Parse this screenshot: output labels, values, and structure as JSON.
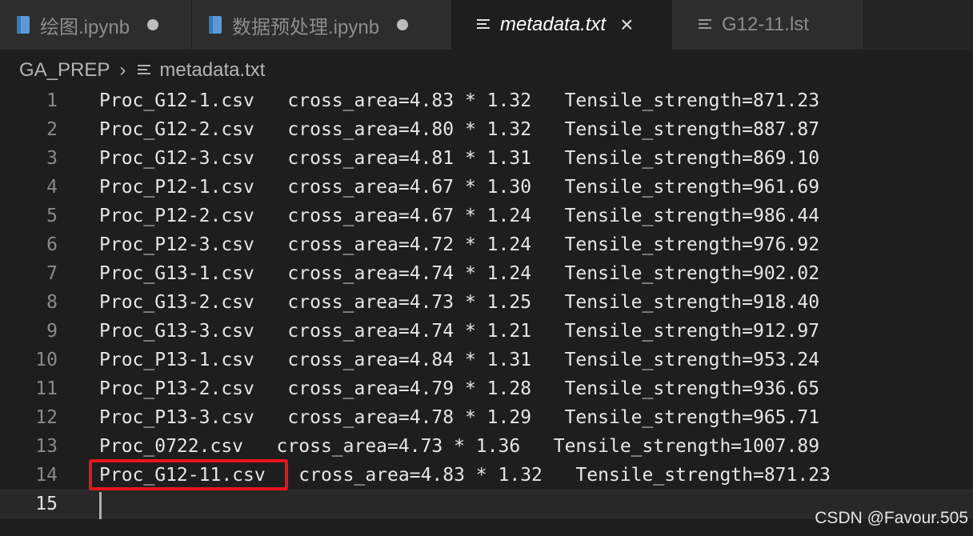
{
  "tabs": [
    {
      "label": "绘图.ipynb",
      "icon": "notebook-icon",
      "state": "modified"
    },
    {
      "label": "数据预处理.ipynb",
      "icon": "notebook-icon",
      "state": "modified"
    },
    {
      "label": "metadata.txt",
      "icon": "text-file-icon",
      "state": "active"
    },
    {
      "label": "G12-11.lst",
      "icon": "text-file-icon",
      "state": "normal"
    }
  ],
  "breadcrumb": {
    "folder": "GA_PREP",
    "file": "metadata.txt"
  },
  "editor": {
    "lines": [
      {
        "num": "1",
        "text": "Proc_G12-1.csv   cross_area=4.83 * 1.32   Tensile_strength=871.23"
      },
      {
        "num": "2",
        "text": "Proc_G12-2.csv   cross_area=4.80 * 1.32   Tensile_strength=887.87"
      },
      {
        "num": "3",
        "text": "Proc_G12-3.csv   cross_area=4.81 * 1.31   Tensile_strength=869.10"
      },
      {
        "num": "4",
        "text": "Proc_P12-1.csv   cross_area=4.67 * 1.30   Tensile_strength=961.69"
      },
      {
        "num": "5",
        "text": "Proc_P12-2.csv   cross_area=4.67 * 1.24   Tensile_strength=986.44"
      },
      {
        "num": "6",
        "text": "Proc_P12-3.csv   cross_area=4.72 * 1.24   Tensile_strength=976.92"
      },
      {
        "num": "7",
        "text": "Proc_G13-1.csv   cross_area=4.74 * 1.24   Tensile_strength=902.02"
      },
      {
        "num": "8",
        "text": "Proc_G13-2.csv   cross_area=4.73 * 1.25   Tensile_strength=918.40"
      },
      {
        "num": "9",
        "text": "Proc_G13-3.csv   cross_area=4.74 * 1.21   Tensile_strength=912.97"
      },
      {
        "num": "10",
        "text": "Proc_P13-1.csv   cross_area=4.84 * 1.31   Tensile_strength=953.24"
      },
      {
        "num": "11",
        "text": "Proc_P13-2.csv   cross_area=4.79 * 1.28   Tensile_strength=936.65"
      },
      {
        "num": "12",
        "text": "Proc_P13-3.csv   cross_area=4.78 * 1.29   Tensile_strength=965.71"
      },
      {
        "num": "13",
        "text": "Proc_0722.csv   cross_area=4.73 * 1.36   Tensile_strength=1007.89"
      },
      {
        "num": "14",
        "text": "Proc_G12-11.csv   cross_area=4.83 * 1.32   Tensile_strength=871.23"
      },
      {
        "num": "15",
        "text": ""
      }
    ]
  },
  "watermark": "CSDN @Favour.505",
  "colors": {
    "background": "#1e1e1e",
    "tabbar": "#252526",
    "highlight": "#e8151b"
  }
}
